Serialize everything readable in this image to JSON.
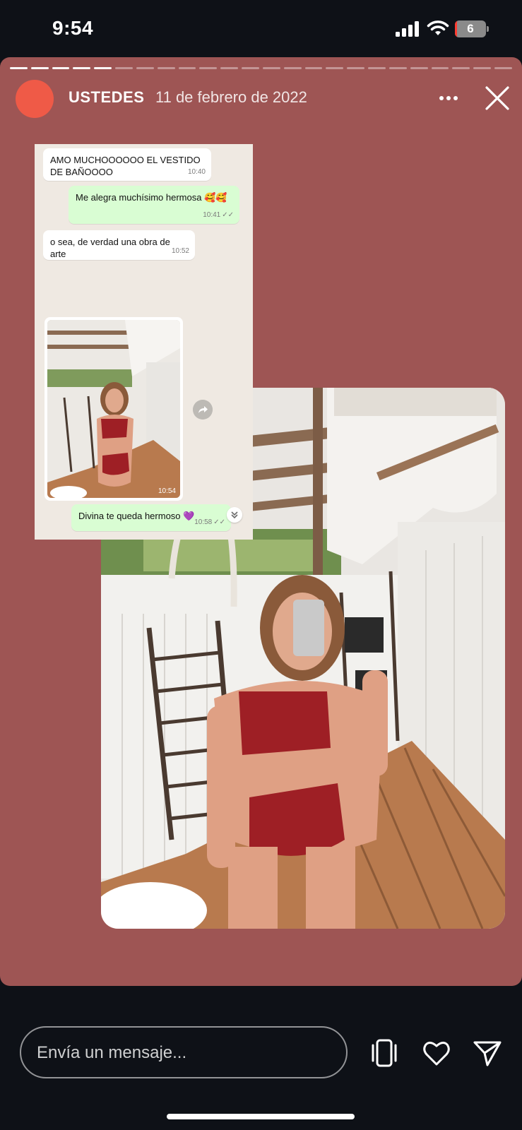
{
  "status": {
    "time": "9:54",
    "battery": "6",
    "battery_fraction": 0.06
  },
  "story": {
    "username": "USTEDES",
    "date": "11 de febrero de 2022",
    "progress": {
      "segments": 24,
      "completed": 5
    },
    "background_color": "#9e5554",
    "avatar_color": "#ef5a47",
    "chat": {
      "messages": [
        {
          "side": "in",
          "text": "AMO MUCHOOOOOO EL VESTIDO DE BAÑOOOO",
          "time": "10:40"
        },
        {
          "side": "out",
          "text": "Me alegra muchísimo hermosa 🥰🥰",
          "time": "10:41"
        },
        {
          "side": "in",
          "text": "o sea, de verdad una obra de arte",
          "time": "10:52"
        },
        {
          "side": "in",
          "type": "image",
          "time": "10:54"
        },
        {
          "side": "out",
          "text": "Divina te queda hermoso 💜",
          "time": "10:58"
        }
      ]
    }
  },
  "reply": {
    "placeholder": "Envía un mensaje..."
  },
  "icons": {
    "more": "more-horizontal-icon",
    "close": "close-icon",
    "share_screen": "phone-icon",
    "like": "heart-icon",
    "send": "send-icon",
    "forward": "forward-icon",
    "scroll_down": "chevron-double-down-icon"
  }
}
